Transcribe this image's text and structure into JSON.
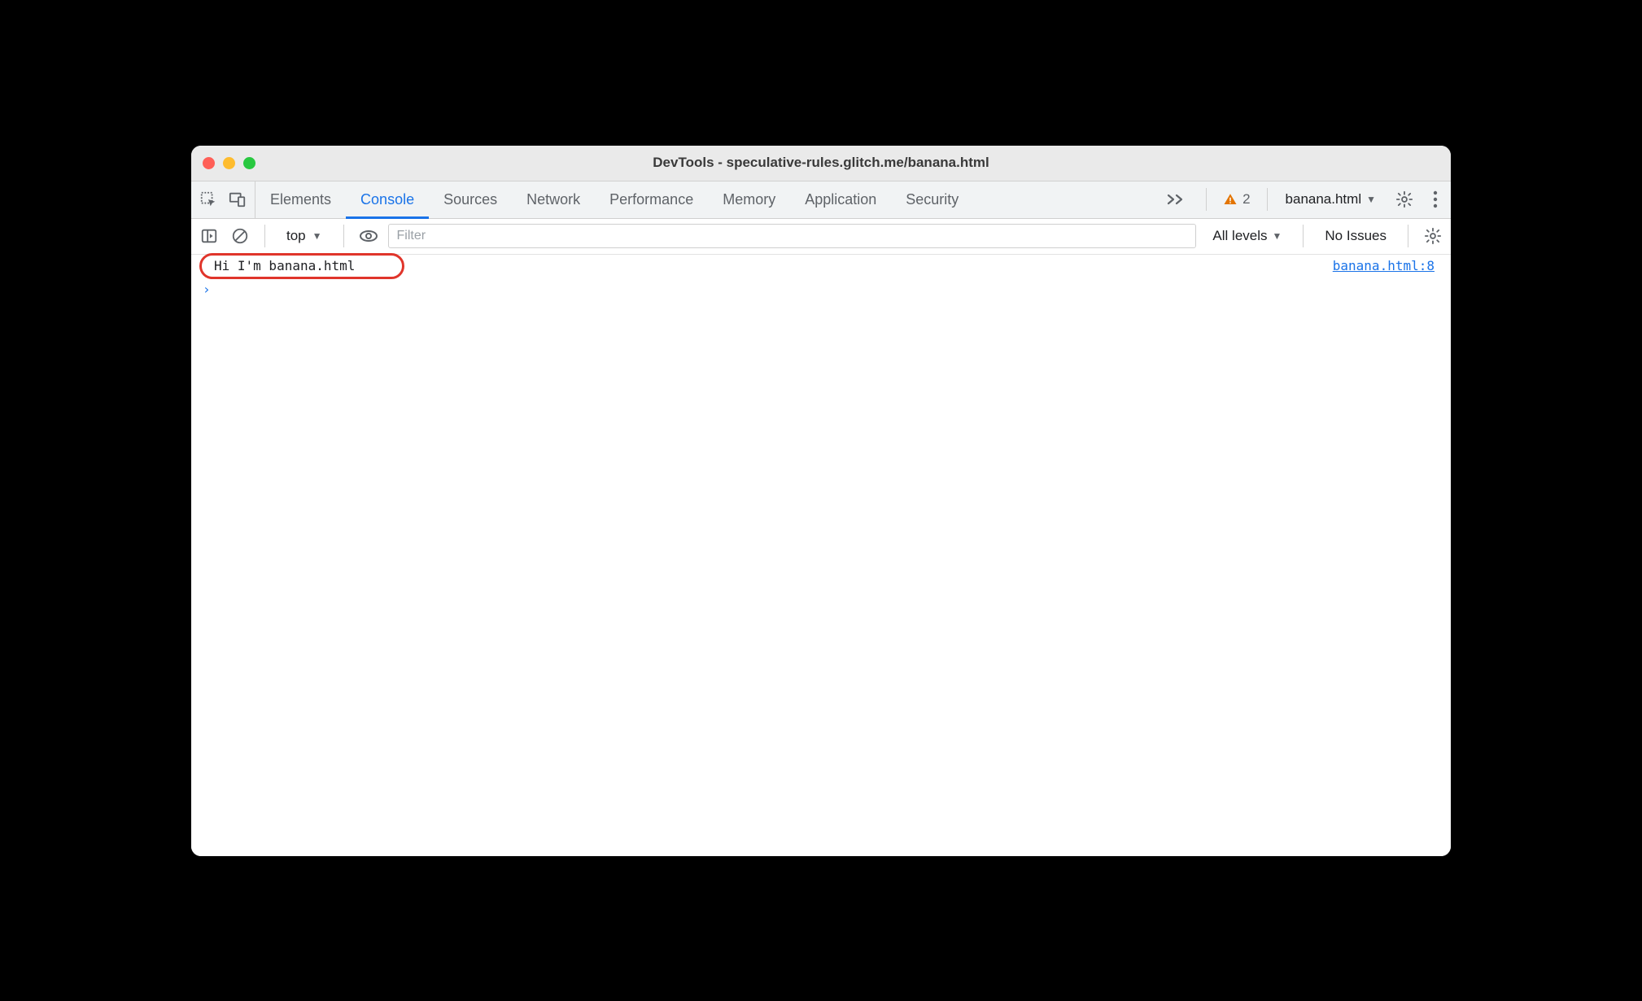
{
  "window": {
    "title": "DevTools - speculative-rules.glitch.me/banana.html"
  },
  "tabs": {
    "items": [
      {
        "label": "Elements",
        "active": false
      },
      {
        "label": "Console",
        "active": true
      },
      {
        "label": "Sources",
        "active": false
      },
      {
        "label": "Network",
        "active": false
      },
      {
        "label": "Performance",
        "active": false
      },
      {
        "label": "Memory",
        "active": false
      },
      {
        "label": "Application",
        "active": false
      },
      {
        "label": "Security",
        "active": false
      }
    ],
    "warnings_count": "2",
    "target": "banana.html"
  },
  "filterbar": {
    "context": "top",
    "filter_placeholder": "Filter",
    "levels_label": "All levels",
    "issues_label": "No Issues"
  },
  "console": {
    "log_message": "Hi I'm banana.html",
    "log_source": "banana.html:8",
    "prompt": "›"
  }
}
